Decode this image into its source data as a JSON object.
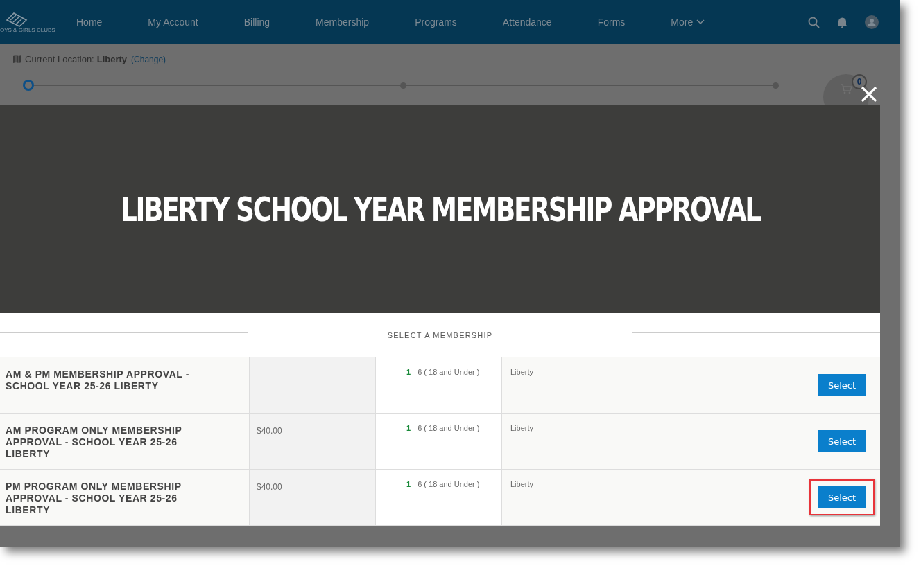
{
  "nav": {
    "logo_text": "OYS & GIRLS CLUBS",
    "items": [
      {
        "label": "Home",
        "dropdown": false
      },
      {
        "label": "My Account",
        "dropdown": false
      },
      {
        "label": "Billing",
        "dropdown": false
      },
      {
        "label": "Membership",
        "dropdown": false
      },
      {
        "label": "Programs",
        "dropdown": false
      },
      {
        "label": "Attendance",
        "dropdown": false
      },
      {
        "label": "Forms",
        "dropdown": false
      },
      {
        "label": "More",
        "dropdown": true
      }
    ]
  },
  "location": {
    "label": "Current Location:",
    "value": "Liberty",
    "link": "(Change)"
  },
  "steps": [
    {
      "selected": true
    },
    {
      "selected": false
    },
    {
      "selected": false
    }
  ],
  "cart": {
    "count": "0"
  },
  "modal": {
    "title": "LIBERTY SCHOOL YEAR MEMBERSHIP APPROVAL",
    "section": "SELECT A MEMBERSHIP",
    "rows": [
      {
        "name": "AM & PM MEMBERSHIP APPROVAL - SCHOOL YEAR 25-26 LIBERTY",
        "count": "1",
        "ages": "6 ( 18  and Under )",
        "location": "Liberty",
        "button": "Select",
        "highlighted": false
      },
      {
        "name": "AM PROGRAM ONLY MEMBERSHIP APPROVAL - SCHOOL YEAR 25-26 LIBERTY",
        "price": "$40.00",
        "count": "1",
        "ages": "6 ( 18  and Under )",
        "location": "Liberty",
        "button": "Select",
        "highlighted": false
      },
      {
        "name": "PM PROGRAM ONLY MEMBERSHIP APPROVAL - SCHOOL YEAR 25-26 LIBERTY",
        "price": "$40.00",
        "count": "1",
        "ages": "6 ( 18  and Under )",
        "location": "Liberty",
        "button": "Select",
        "highlighted": true
      }
    ]
  }
}
